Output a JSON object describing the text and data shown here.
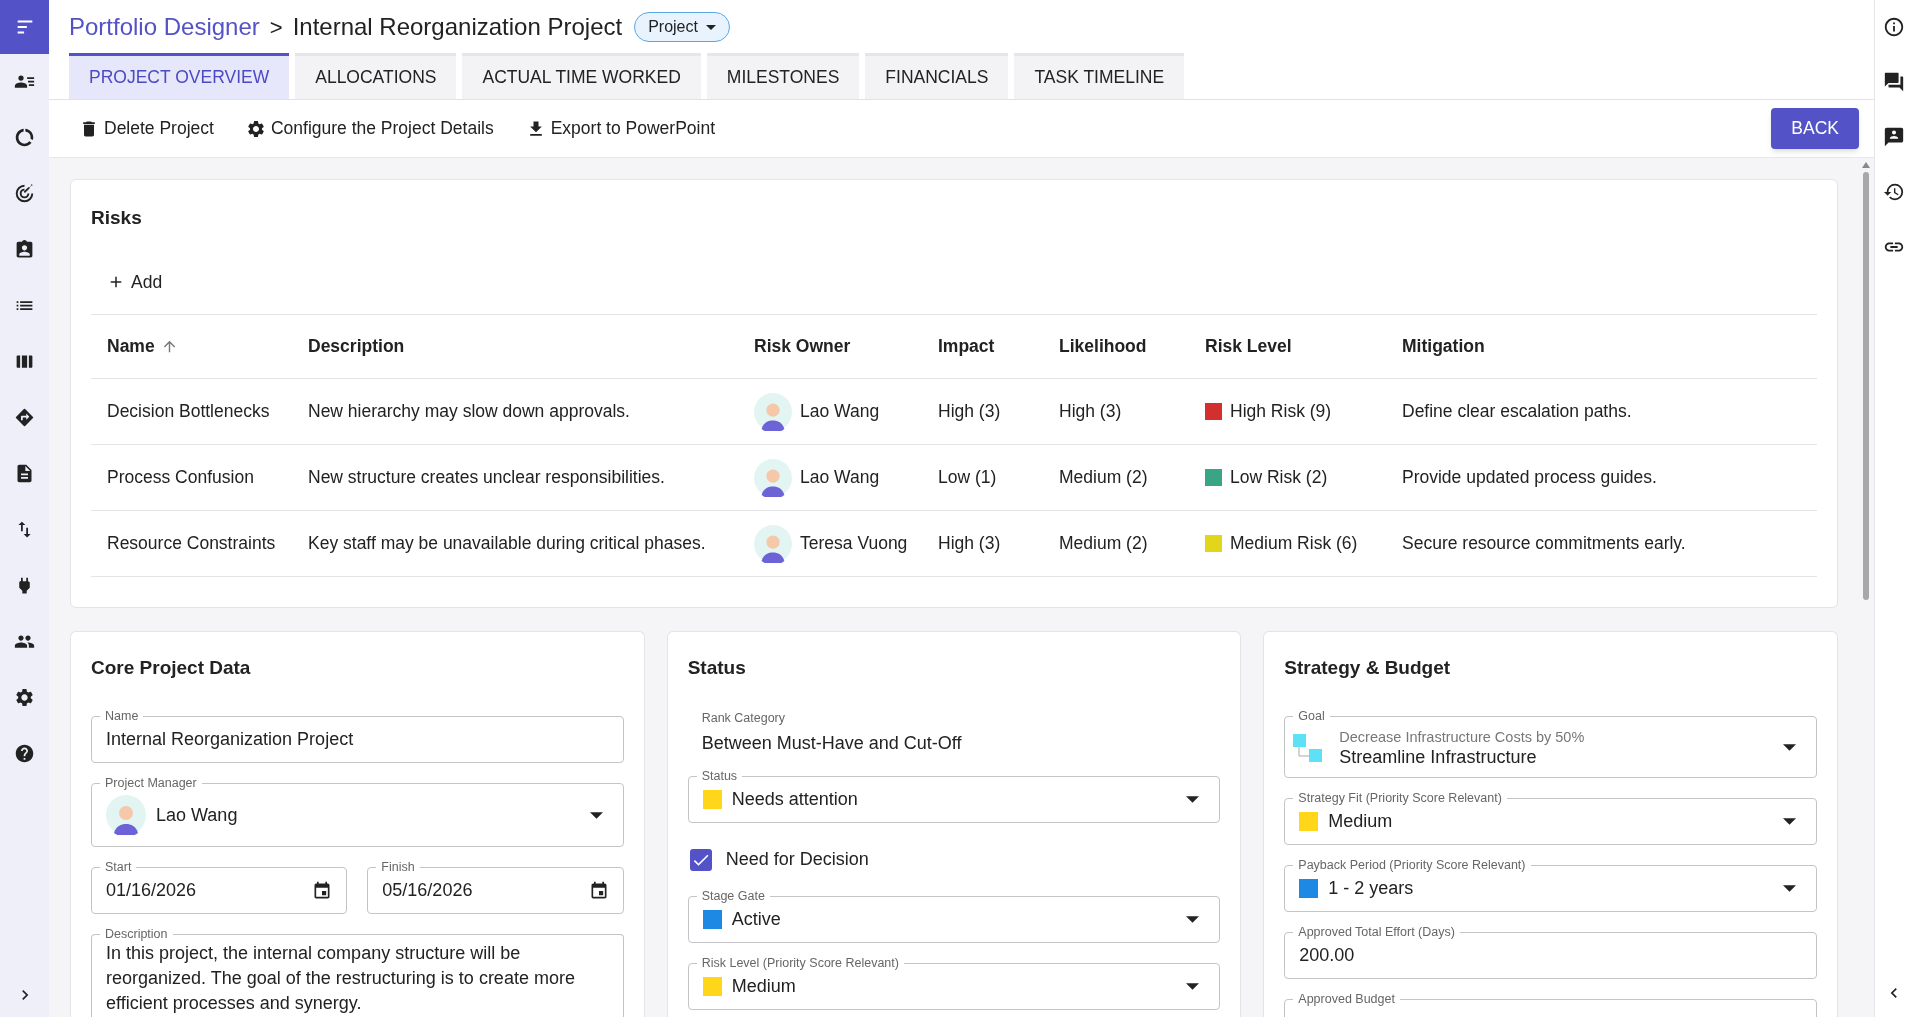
{
  "breadcrumb": {
    "parent": "Portfolio Designer",
    "separator": ">",
    "current": "Internal Reorganization Project",
    "type_chip": "Project"
  },
  "tabs": [
    {
      "label": "PROJECT OVERVIEW",
      "selected": true
    },
    {
      "label": "ALLOCATIONS",
      "selected": false
    },
    {
      "label": "ACTUAL TIME WORKED",
      "selected": false
    },
    {
      "label": "MILESTONES",
      "selected": false
    },
    {
      "label": "FINANCIALS",
      "selected": false
    },
    {
      "label": "TASK TIMELINE",
      "selected": false
    }
  ],
  "toolbar": {
    "actions": [
      {
        "kind": "delete",
        "label": "Delete Project"
      },
      {
        "kind": "configure",
        "label": "Configure the Project Details"
      },
      {
        "kind": "export",
        "label": "Export to PowerPoint"
      }
    ],
    "back_button": "BACK"
  },
  "risks": {
    "title": "Risks",
    "add_button": "Add",
    "columns": [
      {
        "label": "Name",
        "sorted": true
      },
      {
        "label": "Description",
        "sorted": false
      },
      {
        "label": "Risk Owner",
        "sorted": false
      },
      {
        "label": "Impact",
        "sorted": false
      },
      {
        "label": "Likelihood",
        "sorted": false
      },
      {
        "label": "Risk Level",
        "sorted": false
      },
      {
        "label": "Mitigation",
        "sorted": false
      }
    ],
    "rows": [
      {
        "name": "Decision Bottlenecks",
        "description": "New hierarchy may slow down approvals.",
        "owner": "Lao Wang",
        "impact": "High (3)",
        "likelihood": "High (3)",
        "risk_level": {
          "label": "High Risk (9)",
          "color": "#d32f2f"
        },
        "mitigation": "Define clear escalation paths."
      },
      {
        "name": "Process Confusion",
        "description": "New structure creates unclear responsibilities.",
        "owner": "Lao Wang",
        "impact": "Low (1)",
        "likelihood": "Medium (2)",
        "risk_level": {
          "label": "Low Risk (2)",
          "color": "#3aa584"
        },
        "mitigation": "Provide updated process guides."
      },
      {
        "name": "Resource Constraints",
        "description": "Key staff may be unavailable during critical phases.",
        "owner": "Teresa Vuong",
        "impact": "High (3)",
        "likelihood": "Medium (2)",
        "risk_level": {
          "label": "Medium Risk (6)",
          "color": "#e3d41c"
        },
        "mitigation": "Secure resource commitments early."
      }
    ]
  },
  "cards": [
    {
      "title": "Core Project Data",
      "fields": [
        {
          "kind": "text",
          "label": "Name",
          "value": "Internal Reorganization Project"
        },
        {
          "kind": "person",
          "label": "Project Manager",
          "value": "Lao Wang"
        },
        {
          "kind": "dates",
          "items": [
            {
              "label": "Start",
              "value": "01/16/2026"
            },
            {
              "label": "Finish",
              "value": "05/16/2026"
            }
          ]
        },
        {
          "kind": "textarea",
          "label": "Description",
          "value": "In this project, the internal company structure will be reorganized. The goal of the restructuring is to create more efficient processes and synergy."
        }
      ]
    },
    {
      "title": "Status",
      "fields": [
        {
          "kind": "static",
          "label": "Rank Category",
          "value": "Between Must-Have and Cut-Off"
        },
        {
          "kind": "select",
          "label": "Status",
          "value": "Needs attention",
          "color": "#ffd619"
        },
        {
          "kind": "checkbox",
          "label": "Need for Decision",
          "checked": true
        },
        {
          "kind": "select",
          "label": "Stage Gate",
          "value": "Active",
          "color": "#1e88e5"
        },
        {
          "kind": "select",
          "label": "Risk Level (Priority Score Relevant)",
          "value": "Medium",
          "color": "#ffd619"
        }
      ]
    },
    {
      "title": "Strategy & Budget",
      "fields": [
        {
          "kind": "goal",
          "label": "Goal",
          "subtitle": "Decrease Infrastructure Costs by 50%",
          "value": "Streamline Infrastructure",
          "color": "#5ce1f7"
        },
        {
          "kind": "select",
          "label": "Strategy Fit (Priority Score Relevant)",
          "value": "Medium",
          "color": "#ffd619"
        },
        {
          "kind": "select",
          "label": "Payback Period (Priority Score Relevant)",
          "value": "1 - 2 years",
          "color": "#1e88e5"
        },
        {
          "kind": "text",
          "label": "Approved Total Effort (Days)",
          "value": "200.00"
        },
        {
          "kind": "text",
          "label": "Approved Budget"
        }
      ]
    }
  ]
}
